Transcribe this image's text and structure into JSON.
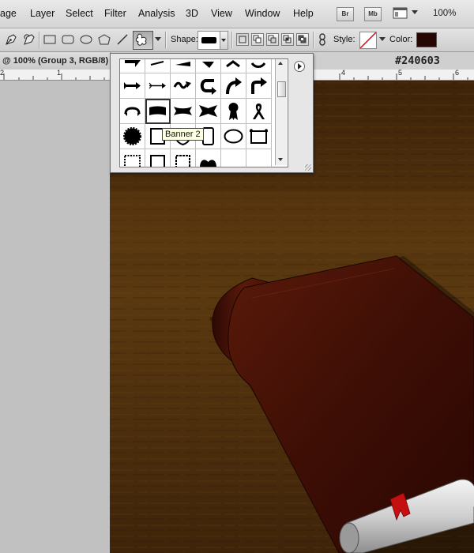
{
  "menubar": {
    "items": [
      "age",
      "Layer",
      "Select",
      "Filter",
      "Analysis",
      "3D",
      "View",
      "Window",
      "Help"
    ],
    "bridge_label": "Br",
    "minibridge_label": "Mb",
    "zoom": "100%"
  },
  "options": {
    "shape_label": "Shape:",
    "style_label": "Style:",
    "color_label": "Color:",
    "color_value": "#240603"
  },
  "document": {
    "title": "@ 100% (Group 3, RGB/8)",
    "hex_label": "#240603",
    "ruler_numbers": [
      "2",
      "1",
      "4",
      "5",
      "6"
    ]
  },
  "shapes_popup": {
    "tooltip": "Banner 2",
    "icons": [
      "arrow-shape",
      "arrow-shape",
      "arrow-shape",
      "arrow-shape",
      "arrow-shape",
      "arrow-shape",
      "arrow-right-icon",
      "arrow-thin-icon",
      "wave-arrow-icon",
      "u-turn-arrow-icon",
      "curved-arrow-icon",
      "turn-arrow-icon",
      "banner-1-icon",
      "banner-2-icon",
      "banner-3-icon",
      "banner-4-icon",
      "ribbon-rosette-icon",
      "ribbon-awareness-icon",
      "seal-icon",
      "frame-square-icon",
      "frame-shield-icon",
      "frame-tall-icon",
      "frame-oval-icon",
      "frame-scroll-icon",
      "frame-stamp-icon",
      "frame-plain-icon",
      "frame-ornate-icon",
      "heart-shape-icon",
      "blank",
      "blank"
    ]
  },
  "colors": {
    "book_leather": "#3a0d05",
    "bookmark": "#c41010",
    "background_wood": "#4a2c0c"
  }
}
